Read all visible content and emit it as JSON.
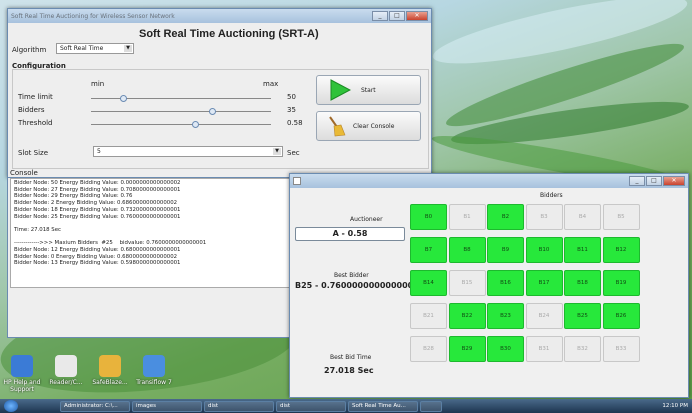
{
  "main_window": {
    "title": "Soft Real Time Auctioning for Wireless Sensor Network",
    "heading": "Soft Real Time Auctioning (SRT-A)",
    "algorithm_label": "Algorithm",
    "algorithm_value": "Soft Real Time",
    "configuration_label": "Configuration",
    "min_label": "min",
    "max_label": "max",
    "rows": [
      {
        "label": "Time limit",
        "value": "50",
        "level": 0.18
      },
      {
        "label": "Bidders",
        "value": "35",
        "level": 0.67
      },
      {
        "label": "Threshold",
        "value": "0.58",
        "level": 0.58
      }
    ],
    "slot_label": "Slot Size",
    "slot_value": "5",
    "slot_unit": "Sec",
    "start_label": "Start",
    "clear_label": "Clear Console",
    "console_label": "Console",
    "console_lines": [
      "Bidder Node: 50 Energy Bidding Value: 0.0000000000000002",
      "Bidder Node: 27 Energy Bidding Value: 0.7080000000000001",
      "Bidder Node: 29 Energy Bidding Value: 0.76",
      "Bidder Node: 2 Energy Bidding Value: 0.6860000000000002",
      "Bidder Node: 18 Energy Bidding Value: 0.7320000000000001",
      "Bidder Node: 25 Energy Bidding Value: 0.7600000000000001",
      "",
      "Time: 27.018 Sec",
      "",
      "------------->>> Maxium Bidders  #25    bidvalue: 0.7600000000000001",
      "Bidder Node: 12 Energy Bidding Value: 0.6800000000000001",
      "Bidder Node: 0 Energy Bidding Value: 0.6800000000000002",
      "Bidder Node: 13 Energy Bidding Value: 0.5980000000000001"
    ]
  },
  "bid_window": {
    "bidders_label": "Bidders",
    "auctioneer_label": "Auctioneer",
    "auctioneer_value": "A - 0.58",
    "best_bidder_label": "Best Bidder",
    "best_bidder_value": "B25 - 0.7600000000000001",
    "best_time_label": "Best Bid Time",
    "best_time_value": "27.018 Sec",
    "cells": [
      {
        "id": "B0",
        "on": true
      },
      {
        "id": "B1",
        "on": false
      },
      {
        "id": "B2",
        "on": true
      },
      {
        "id": "B3",
        "on": false
      },
      {
        "id": "B4",
        "on": false
      },
      {
        "id": "B5",
        "on": false
      },
      {
        "id": "B7",
        "on": true
      },
      {
        "id": "B8",
        "on": true
      },
      {
        "id": "B9",
        "on": true
      },
      {
        "id": "B10",
        "on": true
      },
      {
        "id": "B11",
        "on": true
      },
      {
        "id": "B12",
        "on": true
      },
      {
        "id": "B14",
        "on": true
      },
      {
        "id": "B15",
        "on": false
      },
      {
        "id": "B16",
        "on": true
      },
      {
        "id": "B17",
        "on": true
      },
      {
        "id": "B18",
        "on": true
      },
      {
        "id": "B19",
        "on": true
      },
      {
        "id": "B21",
        "on": false
      },
      {
        "id": "B22",
        "on": true
      },
      {
        "id": "B23",
        "on": true
      },
      {
        "id": "B24",
        "on": false
      },
      {
        "id": "B25",
        "on": true
      },
      {
        "id": "B26",
        "on": true
      },
      {
        "id": "B28",
        "on": false
      },
      {
        "id": "B29",
        "on": true
      },
      {
        "id": "B30",
        "on": true
      },
      {
        "id": "B31",
        "on": false
      },
      {
        "id": "B32",
        "on": false
      },
      {
        "id": "B33",
        "on": false
      }
    ]
  },
  "desktop_icons": [
    {
      "label": "HP Help and Support",
      "color": "#3b7bd6"
    },
    {
      "label": "Reader/C...",
      "color": "#e9e9e9"
    },
    {
      "label": "SafeBlaze...",
      "color": "#e8b33c"
    },
    {
      "label": "Transiflow 7",
      "color": "#4a8ee0"
    }
  ],
  "taskbar": {
    "items": [
      "Administrator: C:\\...",
      "images",
      "dist",
      "dist",
      "Soft Real Time Au...",
      ""
    ],
    "clock": "12:10 PM"
  },
  "colors": {
    "active_cell": "#27e83b",
    "inactive_cell": "#ececec"
  }
}
